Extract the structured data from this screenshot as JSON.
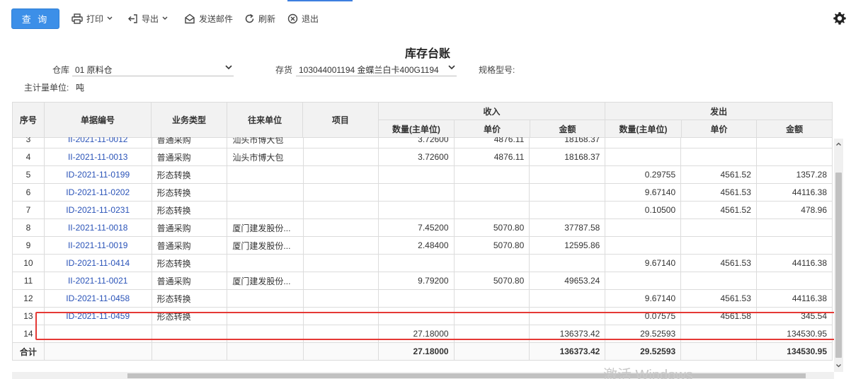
{
  "toolbar": {
    "query": "查 询",
    "print": "打印",
    "export": "导出",
    "send_mail": "发送邮件",
    "refresh": "刷新",
    "exit": "退出"
  },
  "report": {
    "title": "库存台账",
    "warehouse_label": "仓库",
    "warehouse_value": "01 原料仓",
    "inventory_label": "存货",
    "inventory_value": "103044001194 金蝶兰白卡400G1194",
    "spec_label": "规格型号:",
    "unit_label": "主计量单位:",
    "unit_value": "吨"
  },
  "table": {
    "headers": {
      "seq": "序号",
      "doc_no": "单据编号",
      "biz_type": "业务类型",
      "partner": "往来单位",
      "project": "项目",
      "income": "收入",
      "outgo": "发出",
      "qty": "数量(主单位)",
      "price": "单价",
      "amount": "金额"
    },
    "rows": [
      {
        "seq": "3",
        "doc": "II-2021-11-0012",
        "type": "普通采购",
        "partner": "汕头市博大包",
        "project": "",
        "in_qty": "3.72600",
        "in_price": "4876.11",
        "in_amt": "18168.37",
        "out_qty": "",
        "out_price": "",
        "out_amt": ""
      },
      {
        "seq": "4",
        "doc": "II-2021-11-0013",
        "type": "普通采购",
        "partner": "汕头市博大包",
        "project": "",
        "in_qty": "3.72600",
        "in_price": "4876.11",
        "in_amt": "18168.37",
        "out_qty": "",
        "out_price": "",
        "out_amt": ""
      },
      {
        "seq": "5",
        "doc": "ID-2021-11-0199",
        "type": "形态转换",
        "partner": "",
        "project": "",
        "in_qty": "",
        "in_price": "",
        "in_amt": "",
        "out_qty": "0.29755",
        "out_price": "4561.52",
        "out_amt": "1357.28"
      },
      {
        "seq": "6",
        "doc": "ID-2021-11-0202",
        "type": "形态转换",
        "partner": "",
        "project": "",
        "in_qty": "",
        "in_price": "",
        "in_amt": "",
        "out_qty": "9.67140",
        "out_price": "4561.53",
        "out_amt": "44116.38"
      },
      {
        "seq": "7",
        "doc": "ID-2021-11-0231",
        "type": "形态转换",
        "partner": "",
        "project": "",
        "in_qty": "",
        "in_price": "",
        "in_amt": "",
        "out_qty": "0.10500",
        "out_price": "4561.52",
        "out_amt": "478.96"
      },
      {
        "seq": "8",
        "doc": "II-2021-11-0018",
        "type": "普通采购",
        "partner": "厦门建发股份...",
        "project": "",
        "in_qty": "7.45200",
        "in_price": "5070.80",
        "in_amt": "37787.58",
        "out_qty": "",
        "out_price": "",
        "out_amt": ""
      },
      {
        "seq": "9",
        "doc": "II-2021-11-0019",
        "type": "普通采购",
        "partner": "厦门建发股份...",
        "project": "",
        "in_qty": "2.48400",
        "in_price": "5070.80",
        "in_amt": "12595.86",
        "out_qty": "",
        "out_price": "",
        "out_amt": ""
      },
      {
        "seq": "10",
        "doc": "ID-2021-11-0414",
        "type": "形态转换",
        "partner": "",
        "project": "",
        "in_qty": "",
        "in_price": "",
        "in_amt": "",
        "out_qty": "9.67140",
        "out_price": "4561.53",
        "out_amt": "44116.38"
      },
      {
        "seq": "11",
        "doc": "II-2021-11-0021",
        "type": "普通采购",
        "partner": "厦门建发股份...",
        "project": "",
        "in_qty": "9.79200",
        "in_price": "5070.80",
        "in_amt": "49653.24",
        "out_qty": "",
        "out_price": "",
        "out_amt": ""
      },
      {
        "seq": "12",
        "doc": "ID-2021-11-0458",
        "type": "形态转换",
        "partner": "",
        "project": "",
        "in_qty": "",
        "in_price": "",
        "in_amt": "",
        "out_qty": "9.67140",
        "out_price": "4561.53",
        "out_amt": "44116.38"
      },
      {
        "seq": "13",
        "doc": "ID-2021-11-0459",
        "type": "形态转换",
        "partner": "",
        "project": "",
        "in_qty": "",
        "in_price": "",
        "in_amt": "",
        "out_qty": "0.07575",
        "out_price": "4561.58",
        "out_amt": "345.54"
      },
      {
        "seq": "14",
        "doc": "",
        "type": "",
        "partner": "",
        "project": "",
        "in_qty": "27.18000",
        "in_price": "",
        "in_amt": "136373.42",
        "out_qty": "29.52593",
        "out_price": "",
        "out_amt": "134530.95"
      }
    ],
    "total": {
      "label": "合计",
      "in_qty": "27.18000",
      "in_amt": "136373.42",
      "out_qty": "29.52593",
      "out_amt": "134530.95"
    }
  },
  "watermark": "激活 Windows"
}
